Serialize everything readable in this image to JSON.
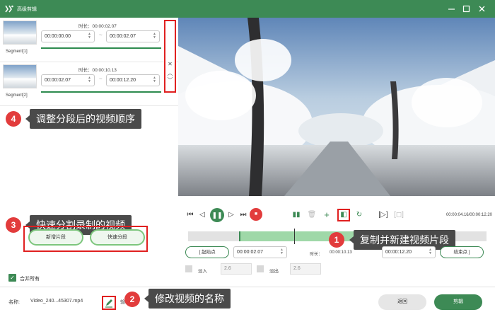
{
  "window": {
    "title": "高级剪辑"
  },
  "segments": [
    {
      "label": "Segment[1]",
      "duration_label": "时长：",
      "duration": "00:00:02.07",
      "start": "00:00:00.00",
      "end": "00:00:02.07"
    },
    {
      "label": "Segment[2]",
      "duration_label": "时长：",
      "duration": "00:00:10.13",
      "start": "00:00:02.07",
      "end": "00:00:12.20"
    }
  ],
  "annotations": {
    "a1": {
      "num": "1",
      "text": "复制并新建视频片段"
    },
    "a2": {
      "num": "2",
      "text": "修改视频的名称"
    },
    "a3": {
      "num": "3",
      "text": "快速分割录制的视频"
    },
    "a4": {
      "num": "4",
      "text": "调整分段后的视频顺序"
    }
  },
  "left_buttons": {
    "new_segment": "新增片段",
    "quick_split": "快速分段"
  },
  "merge_all": "合并所有",
  "player": {
    "time_display": "00:00:04.16/00:00:12.20"
  },
  "trim": {
    "start_label": "起始点",
    "start_time": "00:00:02.07",
    "duration_label": "时长：",
    "duration": "00:00:10.13",
    "end_time": "00:00:12.20",
    "end_label": "结束点"
  },
  "fade": {
    "in_label": "淡入",
    "in_value": "2.6",
    "out_label": "淡出",
    "out_value": "2.6"
  },
  "bottom": {
    "name_label": "名称:",
    "file_name": "Video_240...45307.mp4",
    "output_label": "输出",
    "back": "返回",
    "clip": "剪辑"
  },
  "colors": {
    "brand": "#3d8a55",
    "highlight": "#e02020",
    "callout_bg": "#4a4a4a",
    "badge": "#e23c3c"
  }
}
